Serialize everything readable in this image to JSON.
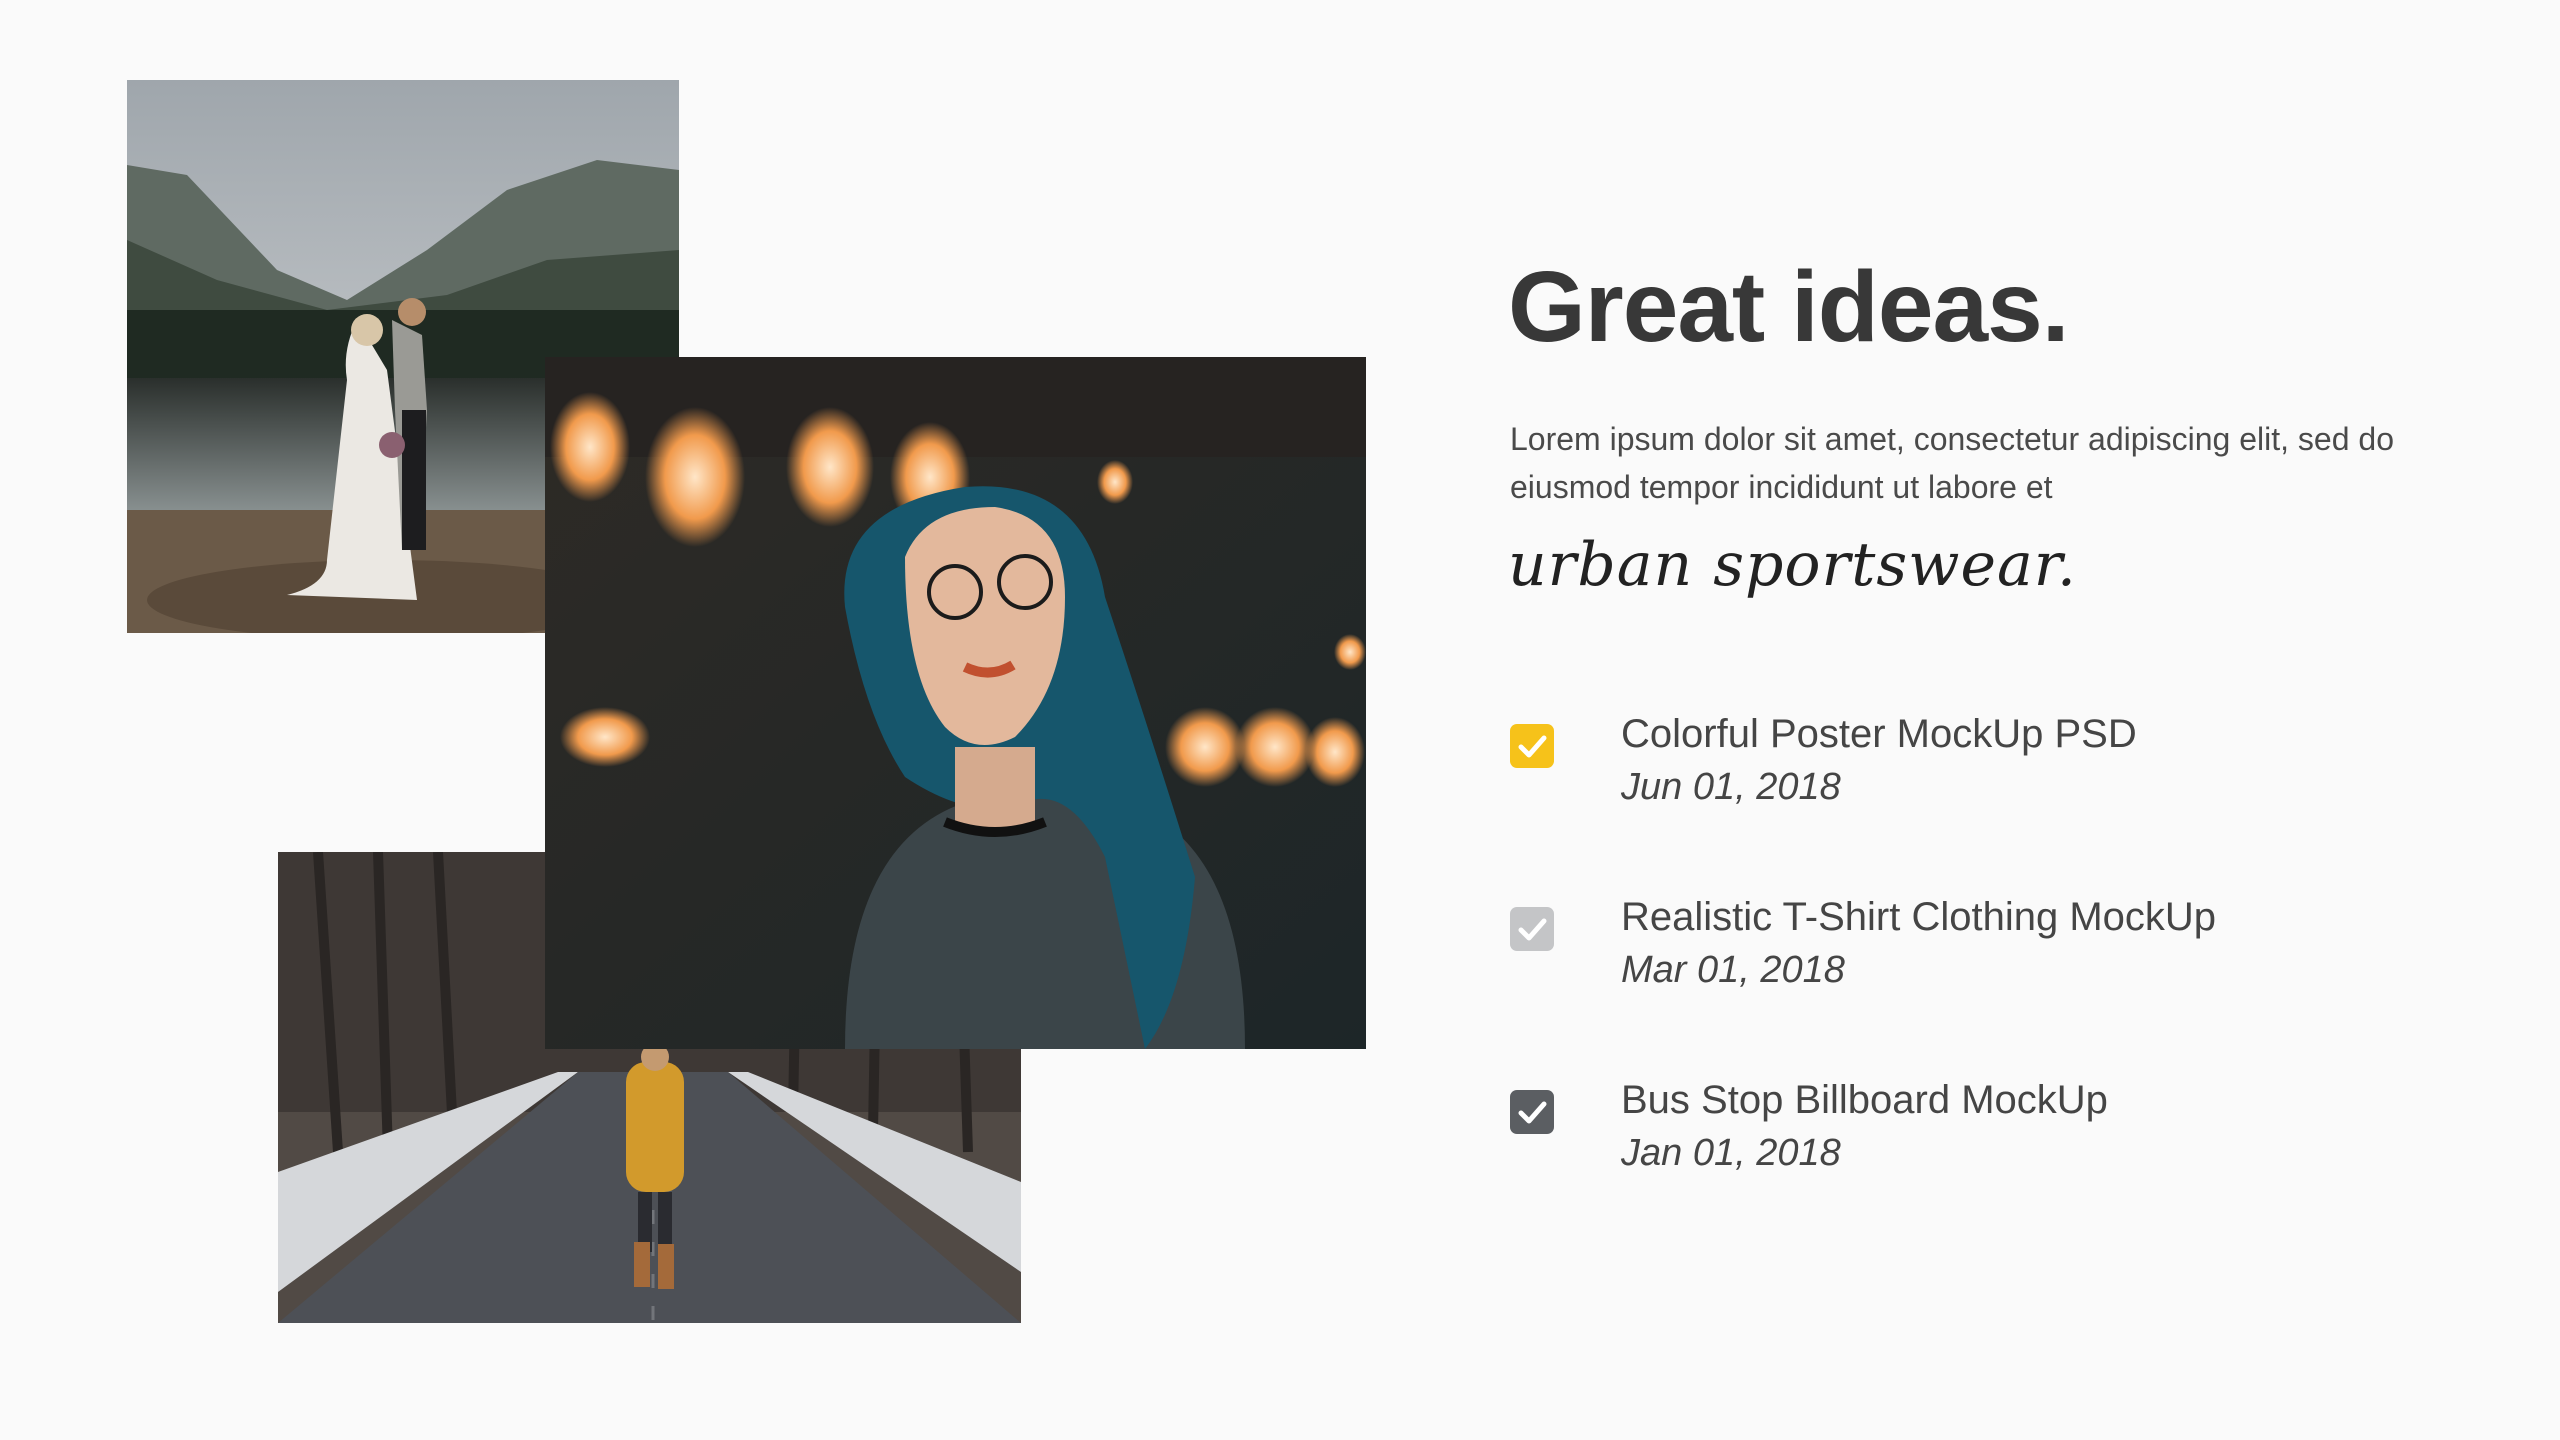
{
  "header": {
    "title": "Great ideas.",
    "description": "Lorem ipsum dolor sit amet, consectetur adipiscing elit, sed do eiusmod tempor incididunt ut labore et",
    "script_tagline": "urban sportswear."
  },
  "items": [
    {
      "name": "Colorful Poster MockUp PSD",
      "date": "Jun 01, 2018",
      "check_color": "#f6c21a"
    },
    {
      "name": "Realistic T-Shirt Clothing MockUp",
      "date": "Mar 01, 2018",
      "check_color": "#c4c5c7"
    },
    {
      "name": "Bus Stop Billboard MockUp",
      "date": "Jan 01, 2018",
      "check_color": "#5b5e62"
    }
  ],
  "photos": [
    {
      "name": "wedding-couple-lake-photo"
    },
    {
      "name": "woman-yellow-coat-road-photo"
    },
    {
      "name": "blue-hair-woman-bokeh-photo"
    }
  ]
}
